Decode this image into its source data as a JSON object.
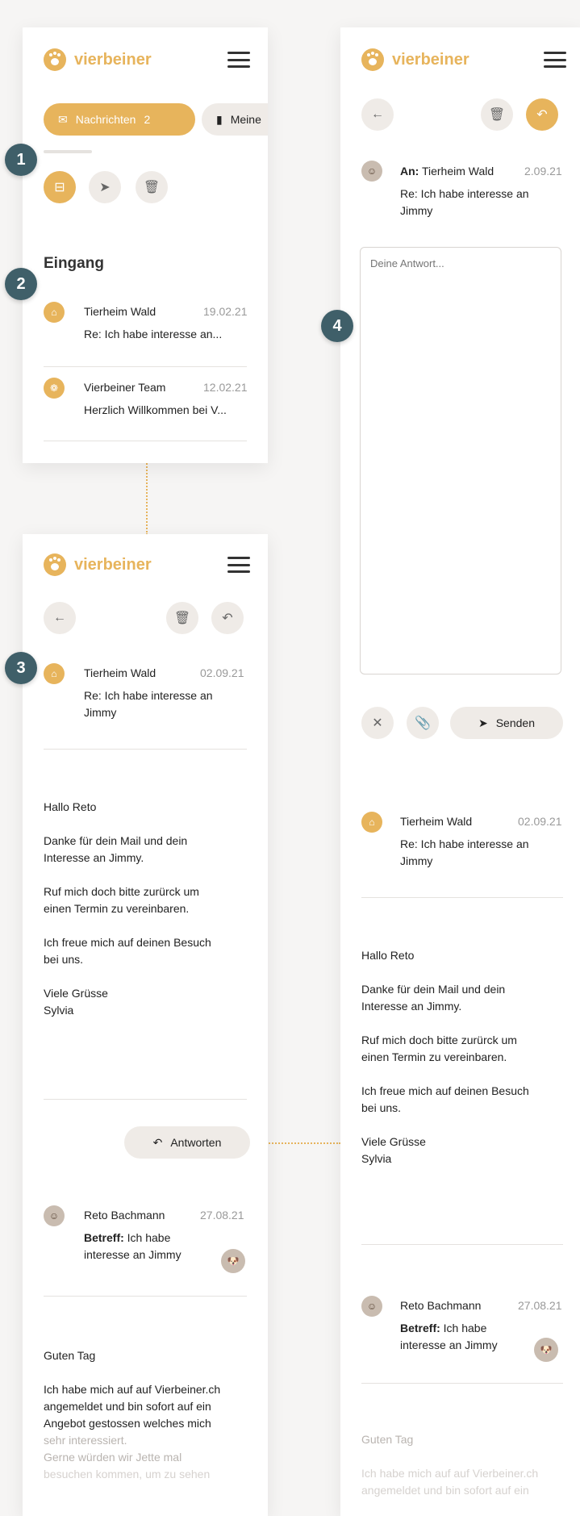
{
  "app": {
    "logo_text": "vierbeiner"
  },
  "markers": [
    "1",
    "2",
    "3",
    "4"
  ],
  "screen1": {
    "tabs": [
      {
        "label": "Nachrichten",
        "count": "2",
        "icon": "mail-icon"
      },
      {
        "label": "Meine",
        "icon": "bookmark-icon"
      }
    ],
    "section_title": "Eingang",
    "messages": [
      {
        "sender": "Tierheim Wald",
        "date": "19.02.21",
        "subject": "Re: Ich habe interesse an..."
      },
      {
        "sender": "Vierbeiner Team",
        "date": "12.02.21",
        "subject": "Herzlich Willkommen bei V..."
      }
    ]
  },
  "screen3": {
    "message": {
      "sender": "Tierheim Wald",
      "date": "02.09.21",
      "subject_line1": "Re: Ich habe interesse an",
      "subject_line2": "Jimmy",
      "body": [
        "Hallo Reto",
        "Danke für dein Mail und dein",
        "Interesse an Jimmy.",
        "Ruf mich doch bitte zurürck um",
        "einen Termin zu vereinbaren.",
        "Ich freue mich auf deinen Besuch",
        "bei uns.",
        "Viele Grüsse",
        "Sylvia"
      ]
    },
    "reply_label": "Antworten",
    "previous": {
      "sender": "Reto Bachmann",
      "date": "27.08.21",
      "subject_prefix": "Betreff:",
      "subject_line1": " Ich habe",
      "subject_line2": "interesse an Jimmy",
      "body": [
        "Guten Tag",
        "Ich habe mich auf auf Vierbeiner.ch",
        "angemeldet und bin sofort auf ein",
        "Angebot gestossen welches mich",
        "sehr interessiert.",
        "Gerne würden wir Jette mal",
        "besuchen kommen, um zu sehen"
      ]
    }
  },
  "screen4": {
    "to_label": "An:",
    "to_name": "Tierheim Wald",
    "date": "2.09.21",
    "subject_line1": "Re: Ich habe interesse an",
    "subject_line2": "Jimmy",
    "reply_placeholder": "Deine Antwort...",
    "send_label": "Senden",
    "quoted": {
      "sender": "Tierheim Wald",
      "date": "02.09.21",
      "subject_line1": "Re: Ich habe interesse an",
      "subject_line2": "Jimmy",
      "body": [
        "Hallo Reto",
        "Danke für dein Mail und dein",
        "Interesse an Jimmy.",
        "Ruf mich doch bitte zurürck um",
        "einen Termin zu vereinbaren.",
        "Ich freue mich auf deinen Besuch",
        "bei uns.",
        "Viele Grüsse",
        "Sylvia"
      ]
    },
    "previous": {
      "sender": "Reto Bachmann",
      "date": "27.08.21",
      "subject_prefix": "Betreff:",
      "subject_line1": " Ich habe",
      "subject_line2": "interesse an Jimmy",
      "body": [
        "Guten Tag",
        "Ich habe mich auf auf Vierbeiner.ch",
        "angemeldet und bin sofort auf ein"
      ]
    }
  },
  "colors": {
    "accent": "#e7b45c",
    "marker": "#3f5f69",
    "button_bg": "#efebe7"
  }
}
